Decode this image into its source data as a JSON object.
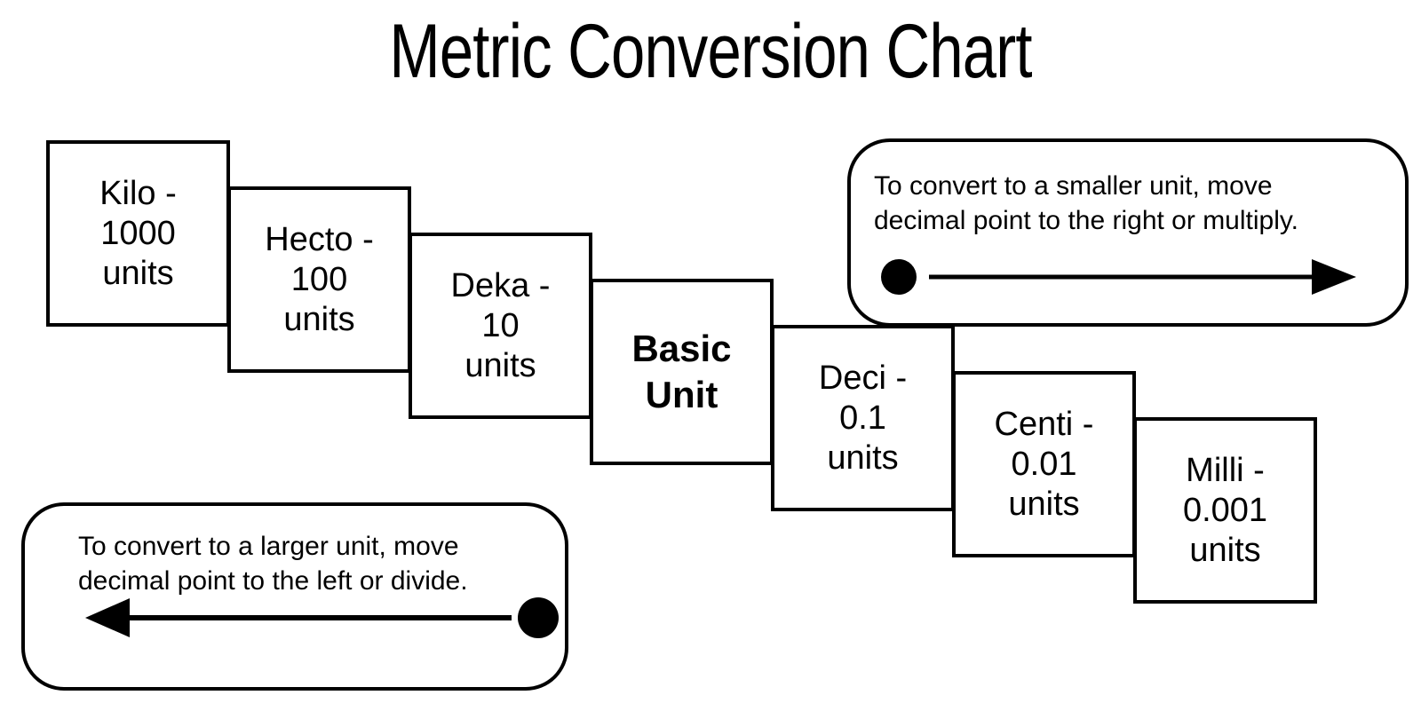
{
  "title": "Metric Conversion Chart",
  "boxes": [
    {
      "name": "kilo",
      "label": "Kilo -\n1000\nunits"
    },
    {
      "name": "hecto",
      "label": "Hecto -\n100\nunits"
    },
    {
      "name": "deka",
      "label": "Deka -\n10\nunits"
    },
    {
      "name": "basic",
      "label": "Basic\nUnit"
    },
    {
      "name": "deci",
      "label": "Deci -\n0.1\nunits"
    },
    {
      "name": "centi",
      "label": "Centi -\n0.01\nunits"
    },
    {
      "name": "milli",
      "label": "Milli -\n0.001\nunits"
    }
  ],
  "callouts": {
    "smaller": {
      "text": "To convert to a smaller unit, move\ndecimal  point to the right or multiply.",
      "direction": "right",
      "marker": "dot"
    },
    "larger": {
      "text": "To convert to a larger unit, move\ndecimal  point to the left or divide.",
      "direction": "left",
      "marker": "dot"
    }
  },
  "colors": {
    "ink": "#000000",
    "paper": "#ffffff"
  }
}
